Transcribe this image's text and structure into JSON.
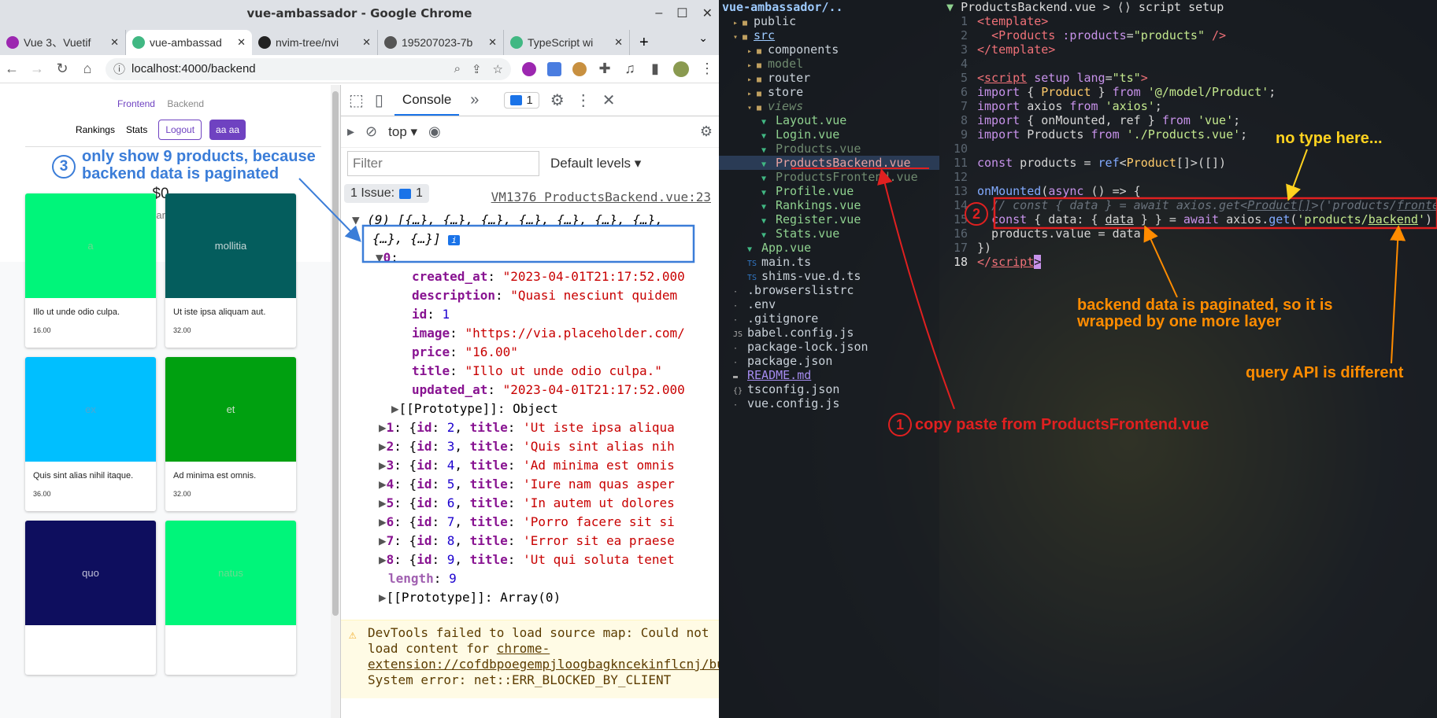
{
  "window": {
    "title": "vue-ambassador - Google Chrome"
  },
  "tabs": [
    {
      "label": "Vue 3、Vuetif",
      "favcolor": "#9c27b0"
    },
    {
      "label": "vue-ambassad",
      "favcolor": "#41b883"
    },
    {
      "label": "nvim-tree/nvi",
      "favcolor": "#222222"
    },
    {
      "label": "195207023-7b",
      "favcolor": "#555555"
    },
    {
      "label": "TypeScript wi",
      "favcolor": "#41b883"
    }
  ],
  "address": {
    "url": "localhost:4000/backend"
  },
  "page": {
    "nav": {
      "frontend": "Frontend",
      "backend": "Backend",
      "rankings": "Rankings",
      "stats": "Stats",
      "logout": "Logout",
      "user": "aa aa"
    },
    "earnings": {
      "amount": "$0",
      "subtitle": "You have earned this far"
    },
    "products": [
      {
        "name": "a",
        "title": "Illo ut unde odio culpa.",
        "price": "16.00",
        "color": "#00f57a",
        "textcolor": "#6bd98f"
      },
      {
        "name": "mollitia",
        "title": "Ut iste ipsa aliquam aut.",
        "price": "32.00",
        "color": "#045d5d",
        "textcolor": "#c8d8d8"
      },
      {
        "name": "ex",
        "title": "Quis sint alias nihil itaque.",
        "price": "36.00",
        "color": "#00bfff",
        "textcolor": "#4fa6d1"
      },
      {
        "name": "et",
        "title": "Ad minima est omnis.",
        "price": "32.00",
        "color": "#00a010",
        "textcolor": "#c8e0c8"
      },
      {
        "name": "quo",
        "title": "",
        "price": "",
        "color": "#0e0e5e",
        "textcolor": "#c0c0d8"
      },
      {
        "name": "natus",
        "title": "",
        "price": "",
        "color": "#00f57a",
        "textcolor": "#6bd98f"
      }
    ]
  },
  "devtools": {
    "tab_console": "Console",
    "message_count": "1",
    "context": "top",
    "filter_placeholder": "Filter",
    "levels": "Default levels",
    "issues": "1 Issue:",
    "issues_count": "1",
    "source": "VM1376 ProductsBackend.vue:23",
    "array_summary": "(9) [{…}, {…}, {…}, {…}, {…}, {…}, {…},",
    "array_summary2": "{…}, {…}]",
    "item0": [
      {
        "k": "created_at",
        "v": "\"2023-04-01T21:17:52.000"
      },
      {
        "k": "description",
        "v": "\"Quasi nesciunt quidem"
      },
      {
        "k": "id",
        "v": "1"
      },
      {
        "k": "image",
        "v": "\"https://via.placeholder.com/"
      },
      {
        "k": "price",
        "v": "\"16.00\""
      },
      {
        "k": "title",
        "v": "\"Illo ut unde odio culpa.\""
      },
      {
        "k": "updated_at",
        "v": "\"2023-04-01T21:17:52.000"
      }
    ],
    "proto_object": "[[Prototype]]: Object",
    "items": [
      {
        "i": "1",
        "id": "2",
        "t": "'Ut iste ipsa aliqua"
      },
      {
        "i": "2",
        "id": "3",
        "t": "'Quis sint alias nih"
      },
      {
        "i": "3",
        "id": "4",
        "t": "'Ad minima est omnis"
      },
      {
        "i": "4",
        "id": "5",
        "t": "'Iure nam quas asper"
      },
      {
        "i": "5",
        "id": "6",
        "t": "'In autem ut dolores"
      },
      {
        "i": "6",
        "id": "7",
        "t": "'Porro facere sit si"
      },
      {
        "i": "7",
        "id": "8",
        "t": "'Error sit ea praese"
      },
      {
        "i": "8",
        "id": "9",
        "t": "'Ut qui soluta tenet"
      }
    ],
    "length_label": "length",
    "length_value": "9",
    "proto_array": "[[Prototype]]: Array(0)",
    "warning_pre": "DevTools failed to load source map: Could not load content for ",
    "warning_link": "chrome-extension://cofdbpoegempjloogbagkncekinflcnj/build/content.js.map",
    "warning_post": ": System error: net::ERR_BLOCKED_BY_CLIENT"
  },
  "editor": {
    "tree_root": "vue-ambassador/..",
    "tree": [
      {
        "label": "public",
        "kind": "folder",
        "indent": 1
      },
      {
        "label": "src",
        "kind": "folder-open",
        "indent": 1,
        "style": "under2"
      },
      {
        "label": "components",
        "kind": "folder",
        "indent": 2
      },
      {
        "label": "model",
        "kind": "folder",
        "indent": 2,
        "style": "dim"
      },
      {
        "label": "router",
        "kind": "folder",
        "indent": 2
      },
      {
        "label": "store",
        "kind": "folder",
        "indent": 2
      },
      {
        "label": "views",
        "kind": "folder-open",
        "indent": 2,
        "style": "dimit"
      },
      {
        "label": "Layout.vue",
        "kind": "vue",
        "indent": 3
      },
      {
        "label": "Login.vue",
        "kind": "vue",
        "indent": 3
      },
      {
        "label": "Products.vue",
        "kind": "vue",
        "indent": 3,
        "style": "dim"
      },
      {
        "label": "ProductsBackend.vue",
        "kind": "vue",
        "indent": 3,
        "style": "sel"
      },
      {
        "label": "ProductsFrontend.vue",
        "kind": "vue",
        "indent": 3,
        "style": "dim"
      },
      {
        "label": "Profile.vue",
        "kind": "vue",
        "indent": 3
      },
      {
        "label": "Rankings.vue",
        "kind": "vue",
        "indent": 3
      },
      {
        "label": "Register.vue",
        "kind": "vue",
        "indent": 3
      },
      {
        "label": "Stats.vue",
        "kind": "vue",
        "indent": 3
      },
      {
        "label": "App.vue",
        "kind": "vue",
        "indent": 2
      },
      {
        "label": "main.ts",
        "kind": "ts",
        "indent": 2
      },
      {
        "label": "shims-vue.d.ts",
        "kind": "ts",
        "indent": 2
      },
      {
        "label": ".browserslistrc",
        "kind": "file",
        "indent": 1
      },
      {
        "label": ".env",
        "kind": "file",
        "indent": 1
      },
      {
        "label": ".gitignore",
        "kind": "file",
        "indent": 1
      },
      {
        "label": "babel.config.js",
        "kind": "js",
        "indent": 1
      },
      {
        "label": "package-lock.json",
        "kind": "file",
        "indent": 1
      },
      {
        "label": "package.json",
        "kind": "file",
        "indent": 1
      },
      {
        "label": "README.md",
        "kind": "md",
        "indent": 1,
        "style": "under"
      },
      {
        "label": "tsconfig.json",
        "kind": "json",
        "indent": 1
      },
      {
        "label": "vue.config.js",
        "kind": "file",
        "indent": 1
      }
    ],
    "breadcrumb": "ProductsBackend.vue > ⟨⟩ script setup",
    "lines": [
      {
        "n": "1",
        "html": "<span class=\"ct\">&lt;template&gt;</span>"
      },
      {
        "n": "2",
        "html": "  <span class=\"ct\">&lt;Products</span> <span class=\"ck\">:products</span>=<span class=\"cs\">\"products\"</span> <span class=\"ct\">/&gt;</span>"
      },
      {
        "n": "3",
        "html": "<span class=\"ct\">&lt;/template&gt;</span>"
      },
      {
        "n": "4",
        "html": ""
      },
      {
        "n": "5",
        "html": "<span class=\"ct\">&lt;<u>script</u></span> <span class=\"ck\">setup</span> <span class=\"ck\">lang</span>=<span class=\"cs\">\"ts\"</span><span class=\"ct\">&gt;</span>"
      },
      {
        "n": "6",
        "html": "<span class=\"ck\">import</span> { <span class=\"cy\">Product</span> } <span class=\"ck\">from</span> <span class=\"cs\">'@/model/Product'</span>;"
      },
      {
        "n": "7",
        "html": "<span class=\"ck\">import</span> axios <span class=\"ck\">from</span> <span class=\"cs\">'axios'</span>;"
      },
      {
        "n": "8",
        "html": "<span class=\"ck\">import</span> { onMounted, ref } <span class=\"ck\">from</span> <span class=\"cs\">'vue'</span>;"
      },
      {
        "n": "9",
        "html": "<span class=\"ck\">import</span> Products <span class=\"ck\">from</span> <span class=\"cs\">'./Products.vue'</span>;"
      },
      {
        "n": "10",
        "html": ""
      },
      {
        "n": "11",
        "html": "<span class=\"ck\">const</span> products = <span class=\"cf\">ref</span>&lt;<span class=\"cy\">Product</span>[]&gt;([])"
      },
      {
        "n": "12",
        "html": ""
      },
      {
        "n": "13",
        "html": "<span class=\"cf\">onMounted</span>(<span class=\"ck\">async</span> () =&gt; {"
      },
      {
        "n": "14",
        "html": "  <span class=\"cc\">// const { data } = await axios.get&lt;<u>Product[]</u>&gt;('products/<u>frontend</u>')</span>"
      },
      {
        "n": "15",
        "html": "  <span class=\"ck\">const</span> { data: { <u>data</u> } } = <span class=\"ck\">await</span> axios.<span class=\"cf\">get</span>(<span class=\"cs\">'products/<u>backend</u>'</span>)"
      },
      {
        "n": "16",
        "html": "  products.value = data"
      },
      {
        "n": "17",
        "html": "})"
      },
      {
        "n": "18",
        "html": "<span class=\"ct\">&lt;/<u>script</u></span><span style=\"background:#c792ea;color:#111\">&gt;</span>"
      }
    ]
  },
  "annotations": {
    "a1_num": "1",
    "a1": "copy paste from ProductsFrontend.vue",
    "a2_num": "2",
    "a3_num": "3",
    "a3_line1": "only show 9 products, because",
    "a3_line2": "backend data is paginated",
    "no_type": "no type here...",
    "wrapped1": "backend data is paginated, so it is",
    "wrapped2": "wrapped by one more layer",
    "query": "query API is different"
  },
  "colors": {
    "accent": "#6f42c1",
    "devtools_blue": "#1a73e8",
    "annotation_red": "#e02020",
    "annotation_orange": "#ff8c00",
    "annotation_yellow": "#ffd21f",
    "annotation_blue": "#3b7dd8"
  }
}
